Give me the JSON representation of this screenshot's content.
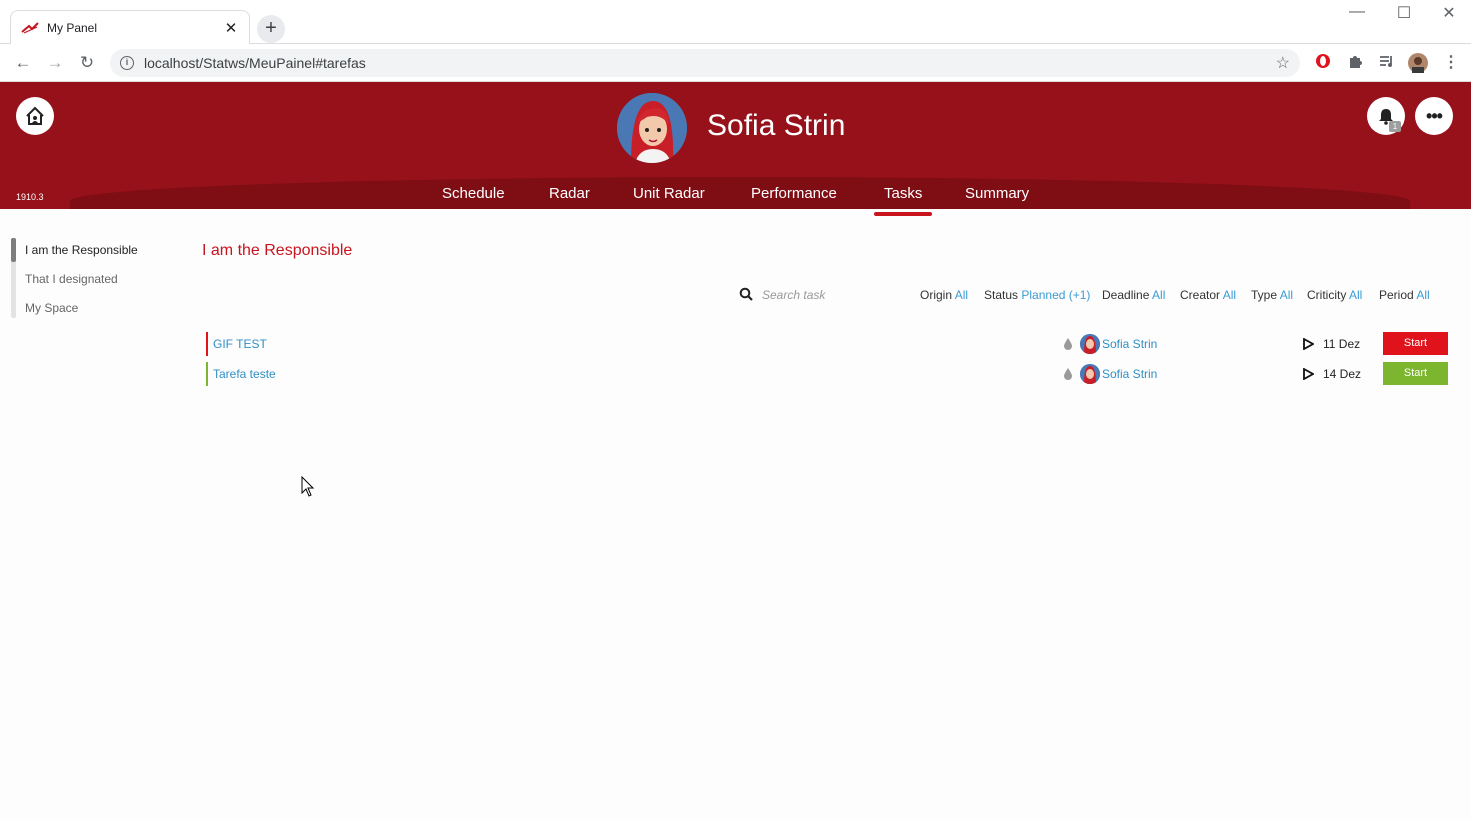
{
  "browser": {
    "tab_title": "My Panel",
    "tab_close": "✕",
    "new_tab": "+",
    "url": "localhost/Statws/MeuPainel#tarefas",
    "window_controls": {
      "minimize": "—",
      "maximize": "☐",
      "close": "✕"
    },
    "nav": {
      "back": "←",
      "forward": "→",
      "reload": "↻"
    },
    "icons": [
      "opera-icon",
      "extensions-icon",
      "media-icon",
      "profile-icon",
      "menu-icon"
    ]
  },
  "header": {
    "version": "1910.3",
    "user_name": "Sofia Strin",
    "notification_count": "1",
    "accent_color": "#961119"
  },
  "nav": {
    "items": [
      {
        "label": "Schedule"
      },
      {
        "label": "Radar"
      },
      {
        "label": "Unit Radar"
      },
      {
        "label": "Performance"
      },
      {
        "label": "Tasks"
      },
      {
        "label": "Summary"
      }
    ],
    "active": "Tasks"
  },
  "sidebar": {
    "items": [
      {
        "label": "I am the Responsible",
        "active": true
      },
      {
        "label": "That I designated",
        "active": false
      },
      {
        "label": "My Space",
        "active": false
      }
    ]
  },
  "main": {
    "title": "I am the Responsible",
    "search_placeholder": "Search task",
    "filters": [
      {
        "label": "Origin",
        "value": "All"
      },
      {
        "label": "Status",
        "value": "Planned (+1)"
      },
      {
        "label": "Deadline",
        "value": "All"
      },
      {
        "label": "Creator",
        "value": "All"
      },
      {
        "label": "Type",
        "value": "All"
      },
      {
        "label": "Criticity",
        "value": "All"
      },
      {
        "label": "Period",
        "value": "All"
      }
    ],
    "tasks": [
      {
        "name": "GIF TEST",
        "owner": "Sofia Strin",
        "date": "11 Dez",
        "action": "Start",
        "color": "#e0121c"
      },
      {
        "name": "Tarefa teste",
        "owner": "Sofia Strin",
        "date": "14 Dez",
        "action": "Start",
        "color": "#7cb52e"
      }
    ]
  }
}
